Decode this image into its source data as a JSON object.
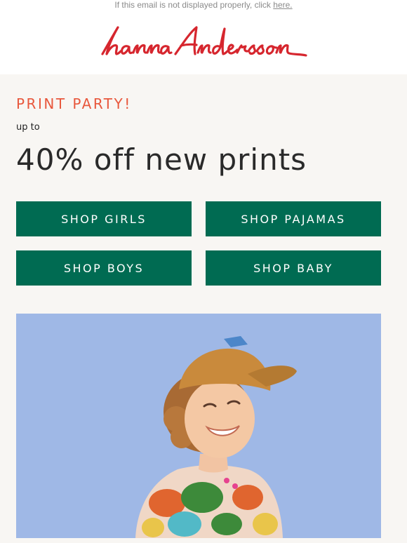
{
  "preheader": {
    "text": "If this email is not displayed properly, click",
    "link": "here."
  },
  "brand": {
    "name": "hanna andersson",
    "color": "#d6262e"
  },
  "promo": {
    "eyebrow": "PRINT PARTY!",
    "lead": "up to",
    "headline": "40% off new prints",
    "accent_color": "#e8573c"
  },
  "buttons": [
    {
      "label": "SHOP GIRLS"
    },
    {
      "label": "SHOP PAJAMAS"
    },
    {
      "label": "SHOP BOYS"
    },
    {
      "label": "SHOP BABY"
    }
  ],
  "button_color": "#006b52",
  "hero_image": {
    "subject": "smiling child in orange cap and dinosaur print sweater",
    "background_color": "#9fb8e6"
  }
}
